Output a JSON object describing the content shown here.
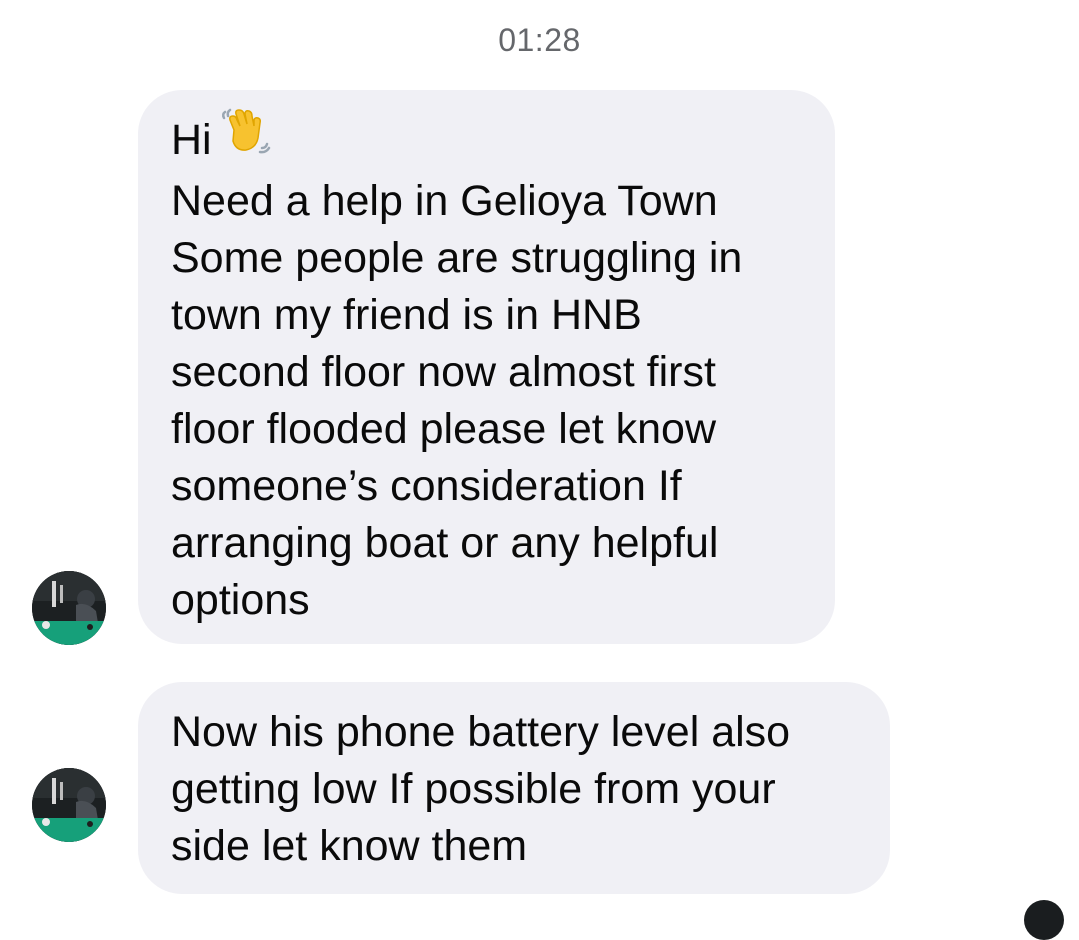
{
  "conversation": {
    "timestamp": "01:28",
    "messages": [
      {
        "lines": [
          "Hi",
          "Need a help in Gelioya Town",
          "Some people are struggling in",
          "town my friend is in HNB",
          "second floor now almost first",
          "floor flooded please let know",
          "someone’s consideration If",
          "arranging boat or any helpful",
          "options"
        ],
        "icon": "waving-hand-icon"
      },
      {
        "lines": [
          "Now his phone battery level also",
          "getting low If possible from your",
          "side let know them"
        ]
      }
    ]
  },
  "colors": {
    "bubble_background": "#f0f0f5",
    "timestamp_text": "#65676b",
    "message_text": "#0a0a0a",
    "wave_emoji": "#f7c22f"
  }
}
